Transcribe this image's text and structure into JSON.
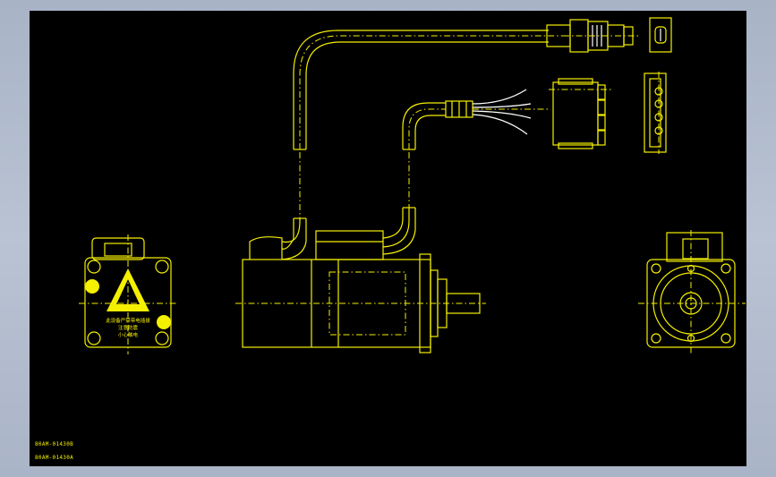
{
  "drawing": {
    "labels": [
      "80AM-01430B",
      "80AM-01430A"
    ],
    "warning_text": [
      "此设备严禁带电插拔",
      "注意防震",
      "小心触电"
    ]
  },
  "colors": {
    "background": "#000000",
    "lines": "#f5f000",
    "highlight": "#ffffff",
    "frame": "#b0bacb"
  }
}
